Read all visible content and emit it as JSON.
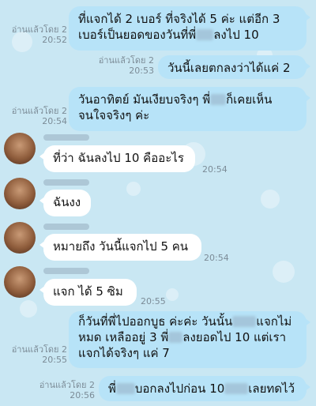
{
  "messages": [
    {
      "line1": "ที่แจกได้ 2 เบอร์  ที่จริงได้ 5 ค่ะ แต่อีก 3",
      "line2a": "เบอร์เป็นยอดของวันที่พี่",
      "line2b": "ลงไป 10",
      "read": "อ่านแล้วโดย 2",
      "time": "20:52"
    },
    {
      "text": "วันนี้เลยตกลงว่าได้แค่ 2",
      "read": "อ่านแล้วโดย 2",
      "time": "20:53"
    },
    {
      "line1a": "วันอาทิตย์ มันเงียบจริงๆ พี่",
      "line1b": "ก็เคยเห็น",
      "line2": "จนใจจริงๆ ค่ะ",
      "read": "อ่านแล้วโดย 2",
      "time": "20:54"
    },
    {
      "text": "ที่ว่า ฉันลงไป 10 คืออะไร",
      "time": "20:54"
    },
    {
      "text": "ฉันงง"
    },
    {
      "text": "หมายถึง วันนี้แจกไป 5 คน",
      "time": "20:54"
    },
    {
      "text": "แจก ได้ 5 ซิม",
      "time": "20:55"
    },
    {
      "line1a": "ก็วันที่พี่ไปออกบูธ ค่ะค่ะ วันนั้น",
      "line1b": "แจกไม่",
      "line2a": "หมด เหลืออยู่ 3 พี่",
      "line2b": "ลงยอดไป 10 แต่เรา",
      "line3": "แจกได้จริงๆ แค่ 7",
      "read": "อ่านแล้วโดย 2",
      "time": "20:55"
    },
    {
      "part1": "พี่",
      "part2": "บอกลงไปก่อน 10",
      "part3": "เลยทดไว้",
      "read": "อ่านแล้วโดย 2",
      "time": "20:56"
    }
  ]
}
